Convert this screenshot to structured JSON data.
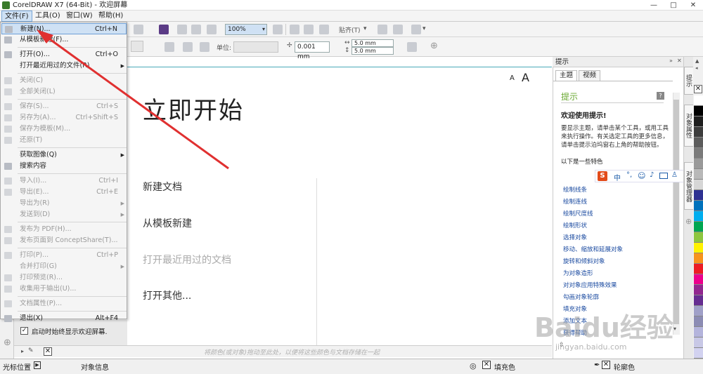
{
  "window": {
    "title": "CorelDRAW X7 (64-Bit) - 欢迎屏幕",
    "minimize": "—",
    "restore": "□",
    "close": "✕"
  },
  "menubar": {
    "items": [
      "文件(F)",
      "工具(O)",
      "窗口(W)",
      "帮助(H)"
    ]
  },
  "toolbar": {
    "zoom_value": "100%",
    "snap_label": "贴齐(T)",
    "units_label": "单位:",
    "nudge_value": "0.001 mm",
    "dup_x": "5.0 mm",
    "dup_y": "5.0 mm"
  },
  "file_menu": {
    "items": [
      {
        "label": "新建(N)...",
        "shortcut": "Ctrl+N",
        "state": "highlight",
        "icon": "new-doc-icon",
        "submenu": false
      },
      {
        "label": "从模板新建(F)...",
        "shortcut": "",
        "state": "normal",
        "icon": "template-icon",
        "submenu": false
      },
      {
        "label": "打开(O)...",
        "shortcut": "Ctrl+O",
        "state": "normal",
        "icon": "open-folder-icon",
        "submenu": false
      },
      {
        "label": "打开最近用过的文件(R)",
        "shortcut": "",
        "state": "normal",
        "icon": "",
        "submenu": true
      },
      {
        "label": "关闭(C)",
        "shortcut": "",
        "state": "disabled",
        "icon": "close-doc-icon",
        "submenu": false
      },
      {
        "label": "全部关闭(L)",
        "shortcut": "",
        "state": "disabled",
        "icon": "close-all-icon",
        "submenu": false
      },
      {
        "label": "保存(S)...",
        "shortcut": "Ctrl+S",
        "state": "disabled",
        "icon": "save-icon",
        "submenu": false
      },
      {
        "label": "另存为(A)...",
        "shortcut": "Ctrl+Shift+S",
        "state": "disabled",
        "icon": "save-as-icon",
        "submenu": false
      },
      {
        "label": "保存为模板(M)...",
        "shortcut": "",
        "state": "disabled",
        "icon": "save-template-icon",
        "submenu": false
      },
      {
        "label": "还原(T)",
        "shortcut": "",
        "state": "disabled",
        "icon": "revert-icon",
        "submenu": false
      },
      {
        "label": "获取图像(Q)",
        "shortcut": "",
        "state": "normal",
        "icon": "",
        "submenu": true
      },
      {
        "label": "搜索内容",
        "shortcut": "",
        "state": "normal",
        "icon": "search-content-icon",
        "submenu": false
      },
      {
        "label": "导入(I)...",
        "shortcut": "Ctrl+I",
        "state": "disabled",
        "icon": "import-icon",
        "submenu": false
      },
      {
        "label": "导出(E)...",
        "shortcut": "Ctrl+E",
        "state": "disabled",
        "icon": "export-icon",
        "submenu": false
      },
      {
        "label": "导出为(R)",
        "shortcut": "",
        "state": "disabled",
        "icon": "",
        "submenu": true
      },
      {
        "label": "发送到(D)",
        "shortcut": "",
        "state": "disabled",
        "icon": "",
        "submenu": true
      },
      {
        "label": "发布为 PDF(H)...",
        "shortcut": "",
        "state": "disabled",
        "icon": "pdf-icon",
        "submenu": false
      },
      {
        "label": "发布页面到 ConceptShare(T)...",
        "shortcut": "",
        "state": "disabled",
        "icon": "conceptshare-icon",
        "submenu": false
      },
      {
        "label": "打印(P)...",
        "shortcut": "Ctrl+P",
        "state": "disabled",
        "icon": "print-icon",
        "submenu": false
      },
      {
        "label": "合并打印(G)",
        "shortcut": "",
        "state": "disabled",
        "icon": "",
        "submenu": true
      },
      {
        "label": "打印预览(R)...",
        "shortcut": "",
        "state": "disabled",
        "icon": "print-preview-icon",
        "submenu": false
      },
      {
        "label": "收集用于输出(U)...",
        "shortcut": "",
        "state": "disabled",
        "icon": "collect-output-icon",
        "submenu": false
      },
      {
        "label": "文档属性(P)...",
        "shortcut": "",
        "state": "disabled",
        "icon": "doc-properties-icon",
        "submenu": false
      },
      {
        "label": "退出(X)",
        "shortcut": "Alt+F4",
        "state": "normal",
        "icon": "exit-icon",
        "submenu": false
      }
    ]
  },
  "welcome": {
    "title": "立即开始",
    "font_small": "A",
    "font_large": "A",
    "links": [
      {
        "label": "新建文档",
        "enabled": true
      },
      {
        "label": "从模板新建",
        "enabled": true
      },
      {
        "label": "打开最近用过的文档",
        "enabled": false
      },
      {
        "label": "打开其他...",
        "enabled": true
      }
    ],
    "startup_checkbox": {
      "checked": true,
      "mark": "✓",
      "label": "启动时始终显示欢迎屏幕."
    }
  },
  "docker": {
    "header": "提示",
    "tabs": [
      "主题",
      "视频"
    ],
    "section_title": "提示",
    "heading": "欢迎使用提示!",
    "body": "要显示主题，请单击某个工具，或用工具来执行操作。有关选定工具的更多信息，请单击提示泊坞窗右上角的帮助按钮。",
    "intro": "以下是一些特色",
    "links": [
      "绘制线条",
      "绘制连线",
      "绘制尺度线",
      "绘制形状",
      "选择对象",
      "移动、缩放和延展对象",
      "旋转和倾斜对象",
      "为对象造形",
      "对对象应用特殊效果",
      "勾画对象轮廓",
      "填充对象",
      "添加文本",
      "获得帮助"
    ]
  },
  "vertical_tabs": [
    "提示",
    "对象属性",
    "对象管理器"
  ],
  "palette_colors": [
    "#ffffff",
    "#000000",
    "#1f1f1f",
    "#3d3d3d",
    "#5c5c5c",
    "#7a7a7a",
    "#999999",
    "#b8b8b8",
    "#d6d6d6",
    "#2e3192",
    "#0072bc",
    "#00aeef",
    "#00a651",
    "#8dc63f",
    "#fff200",
    "#f7941d",
    "#ed1c24",
    "#ec008c",
    "#92278f",
    "#662d91",
    "#a0a0c8",
    "#8c8cb4",
    "#b4b4dc",
    "#c8c8e6",
    "#d2d2f0"
  ],
  "document_palette_hint": "将颜色(或对象)拖动至此处，以便将这些颜色与文档存储在一起",
  "status": {
    "cursor_position": "光标位置",
    "object_info": "对象信息",
    "fill_label": "填充色",
    "outline_label": "轮廓色"
  },
  "watermark": {
    "brand": "Baidu经验",
    "url": "jingyan.baidu.com"
  }
}
